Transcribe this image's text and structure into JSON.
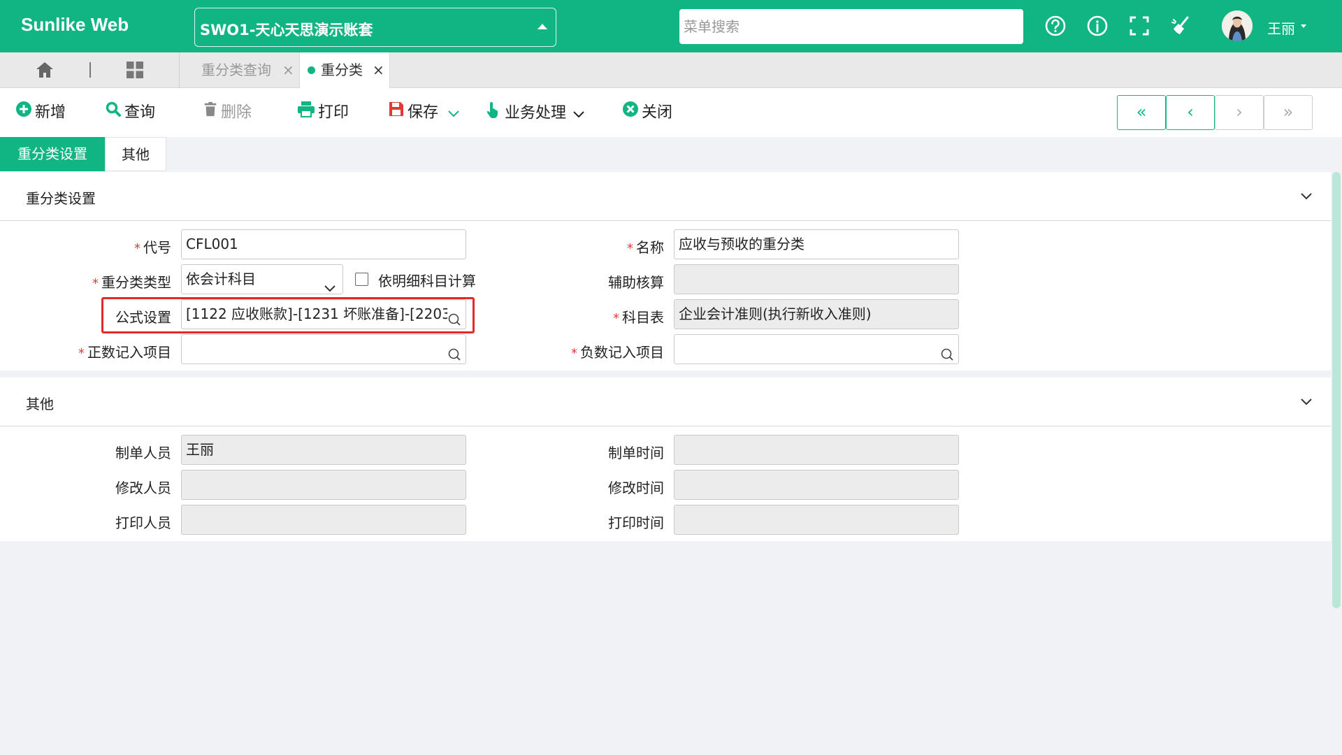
{
  "header": {
    "brand": "Sunlike Web",
    "account": "SWO1-天心天思演示账套",
    "search_placeholder": "菜单搜索",
    "user_name": "王丽",
    "icons": [
      "help-circle-icon",
      "info-circle-icon",
      "fullscreen-icon",
      "broom-icon"
    ]
  },
  "tabbar": {
    "tabs": [
      {
        "label": "重分类查询",
        "active": false
      },
      {
        "label": "重分类",
        "active": true
      }
    ],
    "close_glyph": "×"
  },
  "toolbar": {
    "new_label": "新增",
    "query_label": "查询",
    "delete_label": "删除",
    "print_label": "打印",
    "save_label": "保存",
    "business_label": "业务处理",
    "close_label": "关闭",
    "nav": {
      "first": "«",
      "prev": "‹",
      "next": "›",
      "last": "»"
    }
  },
  "form_tabs": [
    "重分类设置",
    "其他"
  ],
  "section_settings": {
    "title": "重分类设置",
    "code_label": "代号",
    "code_value": "CFL001",
    "name_label": "名称",
    "name_value": "应收与预收的重分类",
    "type_label": "重分类类型",
    "type_value": "依会计科目",
    "detail_calc_label": "依明细科目计算",
    "aux_label": "辅助核算",
    "aux_value": "",
    "formula_label": "公式设置",
    "formula_value": "[1122 应收账款]-[1231 坏账准备]-[2203",
    "chart_label": "科目表",
    "chart_value": "企业会计准则(执行新收入准则)",
    "pos_label": "正数记入项目",
    "pos_value": "",
    "neg_label": "负数记入项目",
    "neg_value": ""
  },
  "section_other": {
    "title": "其他",
    "creator_label": "制单人员",
    "creator_value": "王丽",
    "create_time_label": "制单时间",
    "create_time_value": "",
    "modifier_label": "修改人员",
    "modifier_value": "",
    "modify_time_label": "修改时间",
    "modify_time_value": "",
    "printer_label": "打印人员",
    "printer_value": "",
    "print_time_label": "打印时间",
    "print_time_value": ""
  },
  "colors": {
    "accent": "#11b584",
    "required": "#e53935",
    "highlight_box": "#e12a2a"
  }
}
